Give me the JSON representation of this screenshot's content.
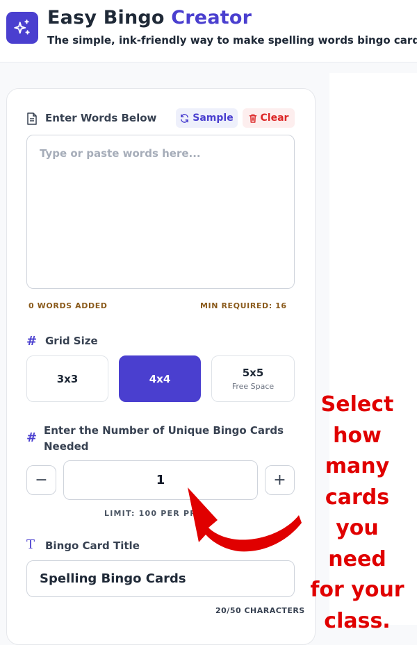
{
  "header": {
    "title_main": "Easy Bingo",
    "title_accent": "Creator",
    "subtitle": "The simple, ink-friendly way to make spelling words bingo cards",
    "logo_icon": "sparkles-icon",
    "accent_color": "#4a3fcf"
  },
  "words": {
    "label": "Enter Words Below",
    "sample_label": "Sample",
    "clear_label": "Clear",
    "placeholder": "Type or paste words here...",
    "value": "",
    "words_added": "0 WORDS ADDED",
    "min_required": "MIN REQUIRED: 16"
  },
  "grid": {
    "label": "Grid Size",
    "options": [
      {
        "label": "3x3",
        "sub": ""
      },
      {
        "label": "4x4",
        "sub": ""
      },
      {
        "label": "5x5",
        "sub": "Free Space"
      }
    ],
    "selected": "4x4"
  },
  "cards": {
    "label": "Enter the Number of Unique Bingo Cards Needed",
    "minus": "−",
    "plus": "+",
    "value": "1",
    "limit": "LIMIT: 100 PER PR"
  },
  "title_field": {
    "label": "Bingo Card Title",
    "value": "Spelling Bingo Cards",
    "char_count": "20/50 CHARACTERS"
  },
  "annotation": {
    "lines": [
      "Select",
      "how",
      "many",
      "cards",
      "you need",
      "for your",
      "class."
    ],
    "color": "#e00000"
  }
}
